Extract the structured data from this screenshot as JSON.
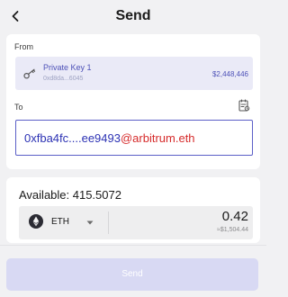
{
  "header": {
    "title": "Send",
    "back_icon": "chevron-left-icon"
  },
  "from": {
    "label": "From",
    "account_name": "Private Key 1",
    "account_address": "0xd8da...6045",
    "balance": "$2,448,446",
    "icon": "key-icon"
  },
  "to": {
    "label": "To",
    "address_part": "0xfba4fc....ee9493",
    "domain_part": "@arbitrum.eth",
    "address_book_icon": "address-book-icon"
  },
  "amount": {
    "available": "Available: 415.5072",
    "token": "ETH",
    "token_icon": "ethereum-icon",
    "value": "0.42",
    "fiat_value": "≈$1,504.44"
  },
  "actions": {
    "send_label": "Send"
  },
  "colors": {
    "accent": "#5b5fc7",
    "account_text": "#4e52b8",
    "address_blue": "#2c32b4",
    "domain_red": "#d62b2b",
    "button_disabled": "#d8d9f3",
    "background": "#f1f1f3"
  }
}
